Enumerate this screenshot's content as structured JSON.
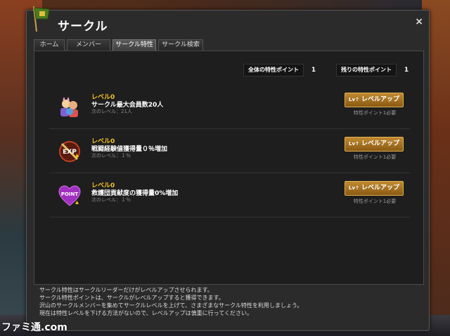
{
  "window": {
    "title": "サークル",
    "close_label": "×"
  },
  "tabs": [
    {
      "label": "ホーム"
    },
    {
      "label": "メンバー"
    },
    {
      "label": "サークル特性"
    },
    {
      "label": "サークル検索"
    }
  ],
  "points": {
    "total_label": "全体の特性ポイント",
    "total_value": "1",
    "remaining_label": "残りの特性ポイント",
    "remaining_value": "1"
  },
  "traits": [
    {
      "icon": "members-icon",
      "level": "レベル0",
      "title": "サークル最大会員数20人",
      "next": "次のレベル：21人",
      "button": "レベルアップ",
      "req": "特性ポイント1必要"
    },
    {
      "icon": "exp-icon",
      "level": "レベル0",
      "title": "戦闘経験値獲得量０％増加",
      "next": "次のレベル：１％",
      "button": "レベルアップ",
      "req": "特性ポイント1必要"
    },
    {
      "icon": "point-icon",
      "level": "レベル0",
      "title": "救護団貢献度の獲得量0%増加",
      "next": "次のレベル：１％",
      "button": "レベルアップ",
      "req": "特性ポイント1必要"
    }
  ],
  "footer": [
    "サークル特性はサークルリーダーだけがレベルアップさせられます。",
    "サークル特性ポイントは、サークルがレベルアップすると獲得できます。",
    "沢山のサークルメンバーを集めてサークルレベルを上げて、さまざまなサークル特性を利用しましょう。",
    "現在は特性レベルを下げる方法がないので、レベルアップは慎重に行ってください。"
  ],
  "watermark": "ファミ通.com",
  "colors": {
    "accent": "#f0c020",
    "button": "#a87020"
  }
}
